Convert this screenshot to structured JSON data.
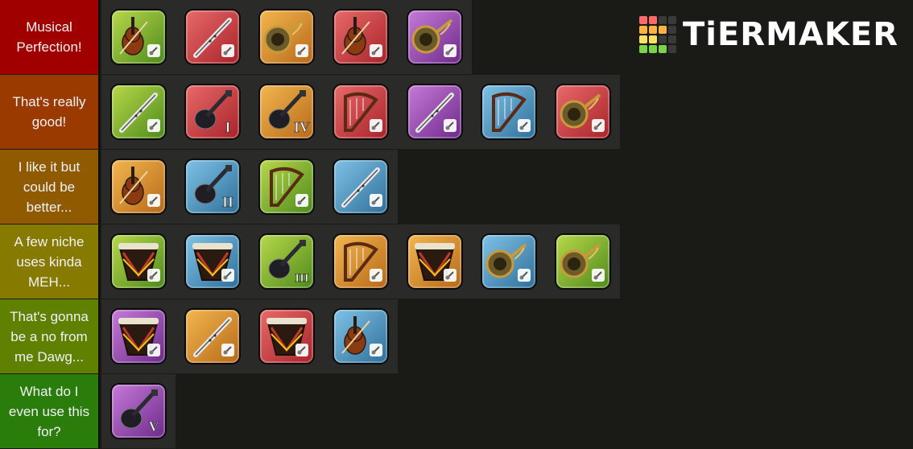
{
  "brand": {
    "name": "TiERMAKER",
    "grid_colors": [
      "#ff6b6b",
      "#ff6b6b",
      "#3a3a3a",
      "#3a3a3a",
      "#ffb347",
      "#ffb347",
      "#ffb347",
      "#3a3a3a",
      "#ffe066",
      "#ffe066",
      "#3a3a3a",
      "#3a3a3a",
      "#7bd34a",
      "#7bd34a",
      "#7bd34a",
      "#3a3a3a"
    ]
  },
  "tiers": [
    {
      "label": "Musical Perfection!",
      "color": "#a10000",
      "items": [
        {
          "name": "violin-icon",
          "bg": "green",
          "glyph": "violin",
          "badge": "cello"
        },
        {
          "name": "flute-icon",
          "bg": "red",
          "glyph": "flute",
          "badge": "flute"
        },
        {
          "name": "horn-icon",
          "bg": "orange",
          "glyph": "horn",
          "badge": "horn"
        },
        {
          "name": "violin-icon",
          "bg": "red",
          "glyph": "violin",
          "badge": "violin"
        },
        {
          "name": "horn-icon",
          "bg": "purple",
          "glyph": "horn",
          "badge": "sax"
        }
      ]
    },
    {
      "label": "That's really good!",
      "color": "#9a3a00",
      "items": [
        {
          "name": "flute-icon",
          "bg": "green",
          "glyph": "flute",
          "badge": "oboe"
        },
        {
          "name": "guitar-icon",
          "bg": "red",
          "glyph": "guitar",
          "badge": "I"
        },
        {
          "name": "guitar-icon",
          "bg": "orange",
          "glyph": "guitar",
          "badge": "IV"
        },
        {
          "name": "harp-icon",
          "bg": "red",
          "glyph": "harp",
          "badge": "harp"
        },
        {
          "name": "flute-icon",
          "bg": "purple",
          "glyph": "flute",
          "badge": "panpipes"
        },
        {
          "name": "harp-icon",
          "bg": "blue",
          "glyph": "harp",
          "badge": "piano"
        },
        {
          "name": "horn-icon",
          "bg": "red",
          "glyph": "horn",
          "badge": "trumpet"
        }
      ]
    },
    {
      "label": "I like it but could be better...",
      "color": "#8f5a00",
      "items": [
        {
          "name": "violin-icon",
          "bg": "orange",
          "glyph": "violin",
          "badge": "violin"
        },
        {
          "name": "guitar-icon",
          "bg": "blue",
          "glyph": "guitar",
          "badge": "II"
        },
        {
          "name": "harp-icon",
          "bg": "green",
          "glyph": "harp",
          "badge": "guitar"
        },
        {
          "name": "flute-icon",
          "bg": "blue",
          "glyph": "flute",
          "badge": "clarinet"
        }
      ]
    },
    {
      "label": "A few niche uses kinda MEH...",
      "color": "#867a00",
      "items": [
        {
          "name": "drum-icon",
          "bg": "green",
          "glyph": "drum",
          "badge": "bongo"
        },
        {
          "name": "drum-icon",
          "bg": "blue",
          "glyph": "drum",
          "badge": "snare"
        },
        {
          "name": "guitar-icon",
          "bg": "green",
          "glyph": "guitar",
          "badge": "III"
        },
        {
          "name": "harp-icon",
          "bg": "orange",
          "glyph": "harp",
          "badge": "stand"
        },
        {
          "name": "drum-icon",
          "bg": "orange",
          "glyph": "drum",
          "badge": "cymbal"
        },
        {
          "name": "horn-icon",
          "bg": "blue",
          "glyph": "horn",
          "badge": "trombone"
        },
        {
          "name": "horn-icon",
          "bg": "green",
          "glyph": "horn",
          "badge": "tuba"
        }
      ]
    },
    {
      "label": "That's gonna be a no from me Dawg...",
      "color": "#5f8000",
      "items": [
        {
          "name": "drum-icon",
          "bg": "purple",
          "glyph": "drum",
          "badge": "bongo"
        },
        {
          "name": "flute-icon",
          "bg": "orange",
          "glyph": "flute",
          "badge": "flute"
        },
        {
          "name": "drum-icon",
          "bg": "red",
          "glyph": "drum",
          "badge": "timpani"
        },
        {
          "name": "violin-icon",
          "bg": "blue",
          "glyph": "violin",
          "badge": "violin"
        }
      ]
    },
    {
      "label": "What do I even use this for?",
      "color": "#2a7d0b",
      "items": [
        {
          "name": "guitar-icon",
          "bg": "purple",
          "glyph": "guitar",
          "badge": "V"
        }
      ]
    }
  ],
  "backgrounds": {
    "green": [
      "#b8d84a",
      "#4e8a1c"
    ],
    "red": [
      "#e86a6a",
      "#a8232a"
    ],
    "orange": [
      "#f2b64e",
      "#b86a1a"
    ],
    "purple": [
      "#c67ad8",
      "#6d2a8a"
    ],
    "blue": [
      "#7fc2e6",
      "#2f6f9a"
    ]
  }
}
